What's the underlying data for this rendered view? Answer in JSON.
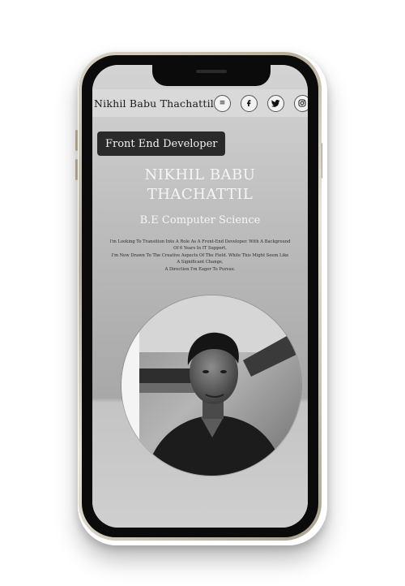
{
  "site": {
    "brand": "Nikhil Babu Thachattil",
    "nav_icons": [
      {
        "name": "menu-icon",
        "glyph": "≡"
      },
      {
        "name": "facebook-icon",
        "glyph": "f"
      },
      {
        "name": "twitter-icon",
        "glyph": "🐦"
      },
      {
        "name": "instagram-icon",
        "glyph": "◎"
      }
    ]
  },
  "hero": {
    "role_badge": "Front End Developer",
    "name_line1": "NIKHIL BABU",
    "name_line2": "THACHATTIL",
    "degree": "B.E Computer Science",
    "bio_lines": [
      "I'm Looking To Transition Into A Role As A Front-End Developer. With A Background",
      "Of 6 Years In IT Support,",
      "I'm Now Drawn To The Creative Aspects Of The Field. While This Might Seem Like",
      "A Significant Change,",
      "A Direction I'm Eager To Pursue."
    ]
  },
  "colors": {
    "badge_bg": "#2a2a2a",
    "hero_text": "#f5f5f5",
    "navbar_bg": "#d9d9d9"
  }
}
